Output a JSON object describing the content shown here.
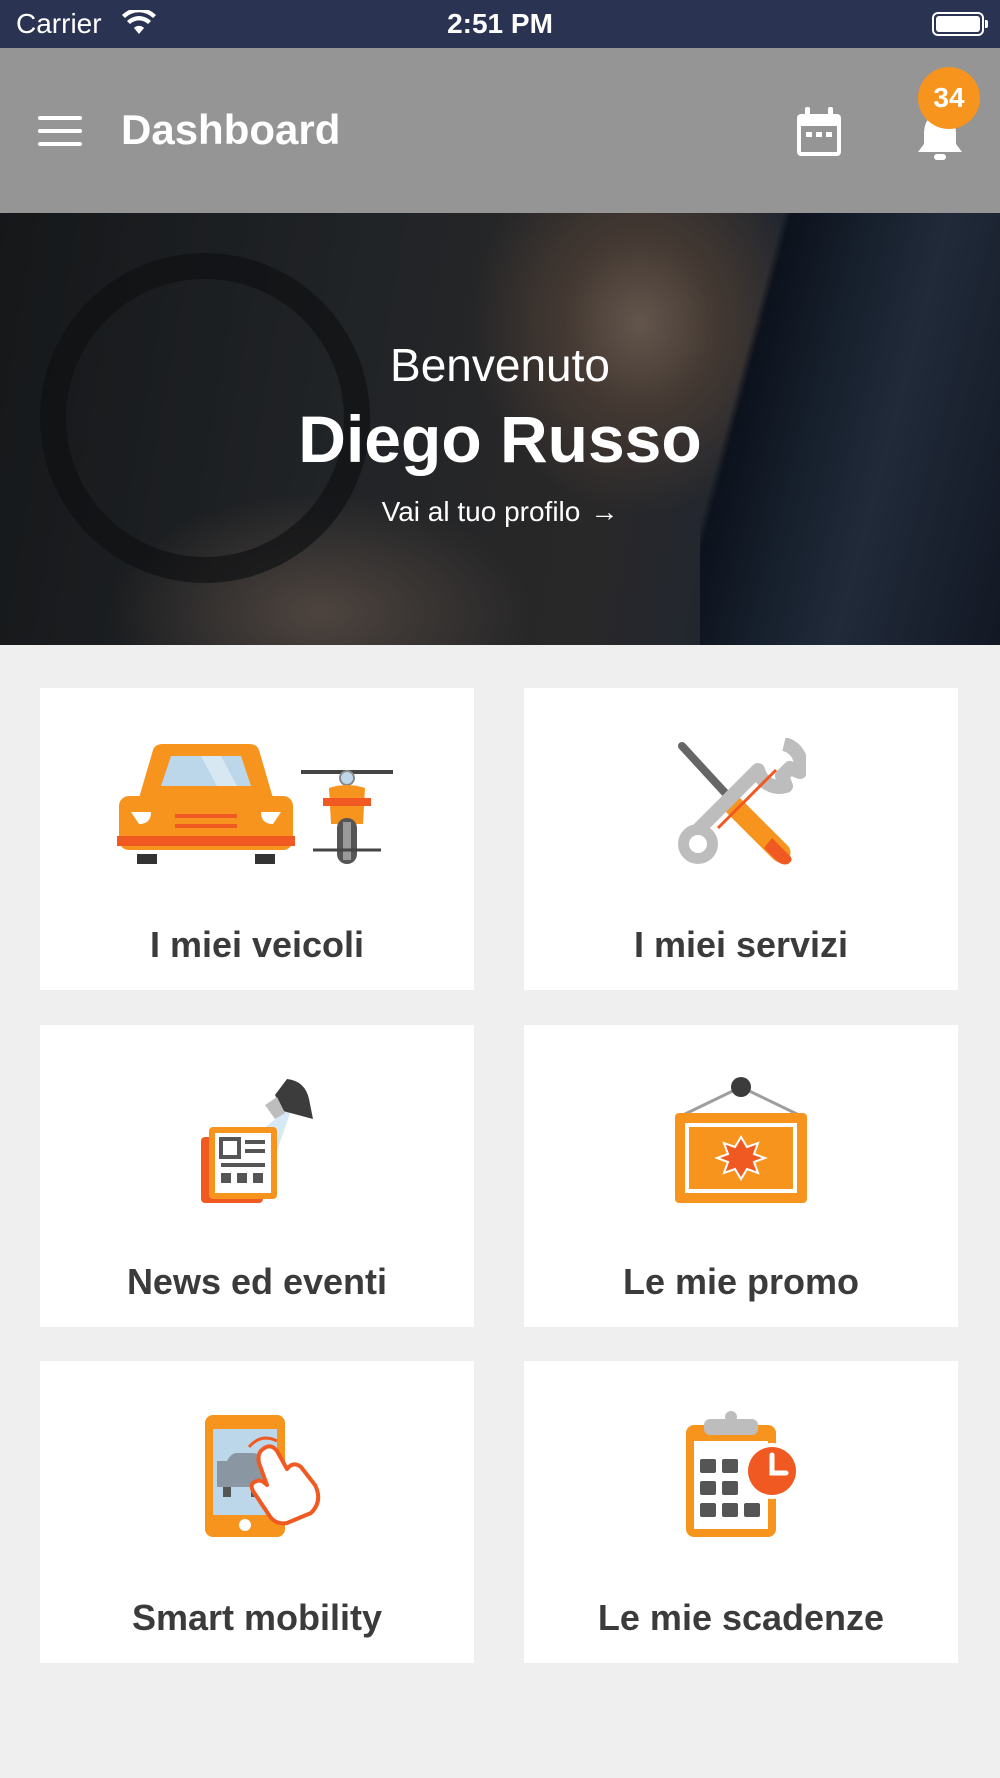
{
  "status_bar": {
    "carrier": "Carrier",
    "time": "2:51 PM",
    "icons": [
      "wifi-icon",
      "battery-icon"
    ]
  },
  "app_bar": {
    "title": "Dashboard",
    "notification_count": "34",
    "icons": [
      "menu-icon",
      "calendar-icon",
      "bell-icon"
    ],
    "background_color": "#959595",
    "badge_color": "#f7941d"
  },
  "hero": {
    "greeting": "Benvenuto",
    "name": "Diego Russo",
    "profile_link": "Vai al tuo profilo",
    "profile_link_arrow": "→"
  },
  "tiles": [
    {
      "label": "I miei veicoli",
      "icon": "vehicles-icon"
    },
    {
      "label": "I miei servizi",
      "icon": "tools-icon"
    },
    {
      "label": "News ed eventi",
      "icon": "news-spotlight-icon"
    },
    {
      "label": "Le mie promo",
      "icon": "promo-sign-icon"
    },
    {
      "label": "Smart mobility",
      "icon": "smart-mobility-icon"
    },
    {
      "label": "Le mie scadenze",
      "icon": "deadlines-clipboard-icon"
    }
  ],
  "colors": {
    "accent": "#f7941d",
    "accent_dark": "#f05a22",
    "status_bar": "#2a3352",
    "page_background": "#efefef"
  }
}
